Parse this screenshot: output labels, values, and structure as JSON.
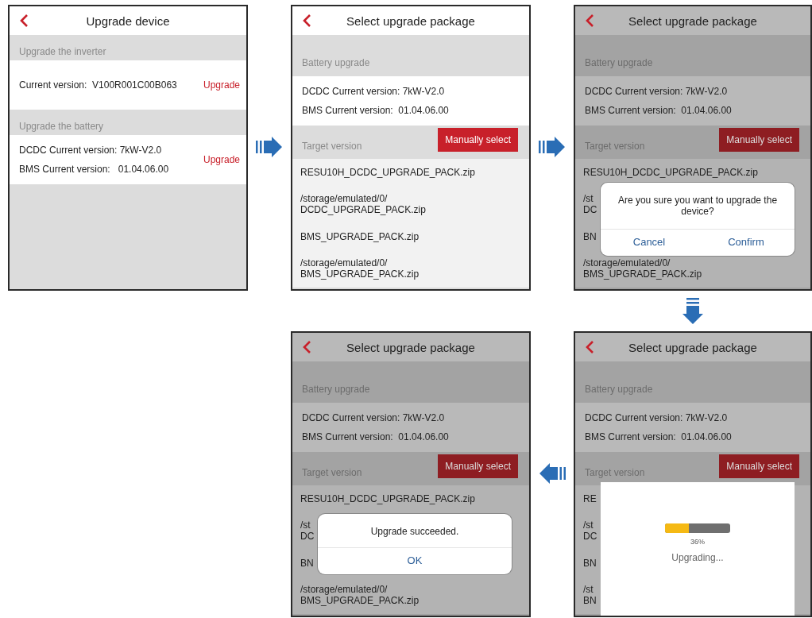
{
  "screens": [
    {
      "title": "Upgrade device",
      "dimmed": false,
      "blocks": [
        {
          "kind": "header",
          "text": "Upgrade the inverter"
        },
        {
          "kind": "info",
          "lines": [
            "Current version:  V100R001C00B063"
          ],
          "action": "Upgrade"
        },
        {
          "kind": "header",
          "text": "Upgrade the battery"
        },
        {
          "kind": "info",
          "lines": [
            "DCDC Current version: 7kW-V2.0",
            "BMS Current version:   01.04.06.00"
          ],
          "action": "Upgrade"
        }
      ]
    },
    {
      "title": "Select upgrade package",
      "dimmed": false,
      "blocks": [
        {
          "kind": "tallheader",
          "text": "Battery upgrade"
        },
        {
          "kind": "info",
          "lines": [
            "DCDC Current version: 7kW-V2.0",
            "BMS Current version:  01.04.06.00"
          ]
        },
        {
          "kind": "header",
          "text": "Target version",
          "button": "Manually select"
        },
        {
          "kind": "file",
          "lines": [
            "RESU10H_DCDC_UPGRADE_PACK.zip"
          ]
        },
        {
          "kind": "file",
          "lines": [
            "/storage/emulated/0/",
            "DCDC_UPGRADE_PACK.zip"
          ]
        },
        {
          "kind": "file",
          "lines": [
            "BMS_UPGRADE_PACK.zip"
          ]
        },
        {
          "kind": "file",
          "lines": [
            "/storage/emulated/0/",
            "BMS_UPGRADE_PACK.zip"
          ]
        }
      ]
    },
    {
      "title": "Select upgrade package",
      "dimmed": true,
      "blocks": [
        {
          "kind": "tallheader",
          "text": "Battery upgrade"
        },
        {
          "kind": "info",
          "lines": [
            "DCDC Current version: 7kW-V2.0",
            "BMS Current version:  01.04.06.00"
          ]
        },
        {
          "kind": "header",
          "text": "Target version",
          "button": "Manually select"
        },
        {
          "kind": "file",
          "lines": [
            "RESU10H_DCDC_UPGRADE_PACK.zip"
          ]
        },
        {
          "kind": "file",
          "lines": [
            "/st",
            "DC"
          ]
        },
        {
          "kind": "file",
          "lines": [
            "BN"
          ]
        },
        {
          "kind": "file",
          "lines": [
            "/storage/emulated/0/",
            "BMS_UPGRADE_PACK.zip"
          ]
        }
      ],
      "dialog": {
        "kind": "confirm",
        "message": "Are you sure you want to upgrade the device?",
        "buttons": [
          "Cancel",
          "Confirm"
        ]
      }
    },
    {
      "title": "Select upgrade package",
      "dimmed": true,
      "blocks": [
        {
          "kind": "tallheader",
          "text": "Battery upgrade"
        },
        {
          "kind": "info",
          "lines": [
            "DCDC Current version: 7kW-V2.0",
            "BMS Current version:  01.04.06.00"
          ]
        },
        {
          "kind": "header",
          "text": "Target version",
          "button": "Manually select"
        },
        {
          "kind": "file",
          "lines": [
            "RESU10H_DCDC_UPGRADE_PACK.zip"
          ]
        },
        {
          "kind": "file",
          "lines": [
            "/st",
            "DC"
          ]
        },
        {
          "kind": "file",
          "lines": [
            "BN"
          ]
        },
        {
          "kind": "file",
          "lines": [
            "/storage/emulated/0/",
            "BMS_UPGRADE_PACK.zip"
          ]
        }
      ],
      "dialog": {
        "kind": "alert",
        "message": "Upgrade succeeded.",
        "buttons": [
          "OK"
        ]
      }
    },
    {
      "title": "Select upgrade package",
      "dimmed": true,
      "blocks": [
        {
          "kind": "tallheader",
          "text": "Battery upgrade"
        },
        {
          "kind": "info",
          "lines": [
            "DCDC Current version: 7kW-V2.0",
            "BMS Current version:  01.04.06.00"
          ]
        },
        {
          "kind": "header",
          "text": "Target version",
          "button": "Manually select"
        },
        {
          "kind": "file",
          "lines": [
            "RE"
          ]
        },
        {
          "kind": "file",
          "lines": [
            "/st",
            "DC"
          ]
        },
        {
          "kind": "file",
          "lines": [
            "BN"
          ]
        },
        {
          "kind": "file",
          "lines": [
            "/st",
            "BN"
          ]
        }
      ],
      "dialog": {
        "kind": "progress",
        "level": 0.36,
        "reading": "36%",
        "message": "Upgrading..."
      }
    }
  ]
}
